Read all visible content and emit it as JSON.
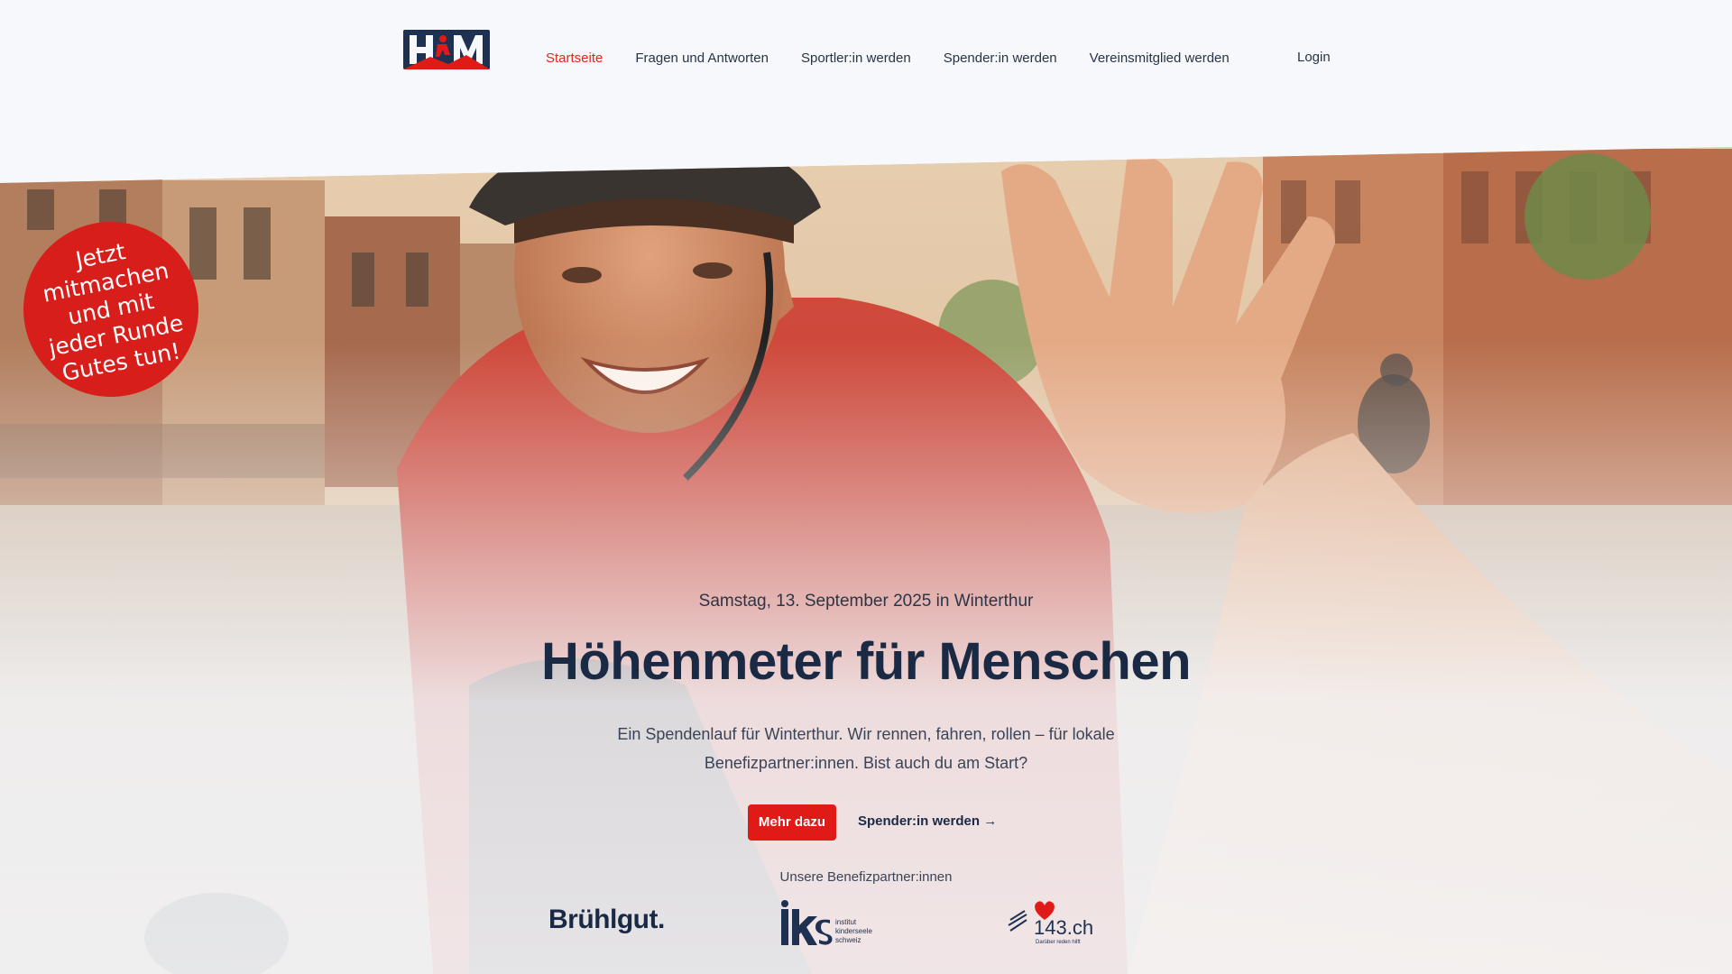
{
  "header": {
    "logo_alt": "HfM",
    "nav": [
      {
        "label": "Startseite",
        "active": true
      },
      {
        "label": "Fragen und Antworten",
        "active": false
      },
      {
        "label": "Sportler:in werden",
        "active": false
      },
      {
        "label": "Spender:in werden",
        "active": false
      },
      {
        "label": "Vereinsmitglied werden",
        "active": false
      }
    ],
    "login": "Login"
  },
  "badge": {
    "lines": [
      "Jetzt",
      "mitmachen",
      "und mit",
      "jeder Runde",
      "Gutes tun!"
    ]
  },
  "hero": {
    "date_line": "Samstag, 13. September 2025 in Winterthur",
    "headline": "Höhenmeter für Menschen",
    "lead": "Ein Spendenlauf für Winterthur. Wir rennen, fahren, rollen – für lokale Benefizpartner:innen. Bist auch du am Start?",
    "primary_button": "Mehr dazu",
    "secondary_link": "Spender:in werden →"
  },
  "partners": {
    "label": "Unsere Benefizpartner:innen",
    "items": [
      {
        "name": "Brühlgut."
      },
      {
        "name": "iks",
        "sub": [
          "institut",
          "kinderseele",
          "schweiz"
        ]
      },
      {
        "name": "143.ch",
        "sub": "Darüber reden hilft"
      }
    ]
  },
  "colors": {
    "accent": "#e01b17",
    "navy": "#1b2a44",
    "background": "#f6f8fb"
  }
}
